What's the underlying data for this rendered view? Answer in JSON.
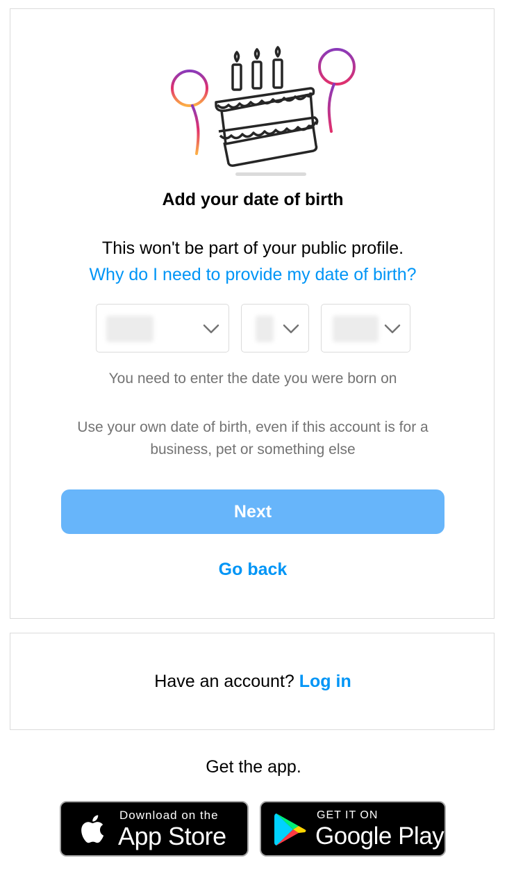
{
  "signup": {
    "heading": "Add your date of birth",
    "subtitle": "This won't be part of your public profile.",
    "why_link": "Why do I need to provide my date of birth?",
    "hint": "You need to enter the date you were born on",
    "note": "Use your own date of birth, even if this account is for a business, pet or something else",
    "next_label": "Next",
    "go_back_label": "Go back"
  },
  "login_box": {
    "prompt": "Have an account?",
    "link": "Log in"
  },
  "app": {
    "get_app": "Get the app.",
    "apple_small": "Download on the",
    "apple_big": "App Store",
    "google_small": "GET IT ON",
    "google_big": "Google Play"
  },
  "colors": {
    "link_blue": "#0095f6",
    "button_disabled_blue": "#67b5fa",
    "border_gray": "#dbdbdb",
    "secondary_text": "#737373"
  },
  "icons": {
    "illustration": "birthday-cake-with-balloons-icon",
    "dropdown": "chevron-down-icon",
    "apple": "apple-logo-icon",
    "google_play": "google-play-logo-icon"
  }
}
